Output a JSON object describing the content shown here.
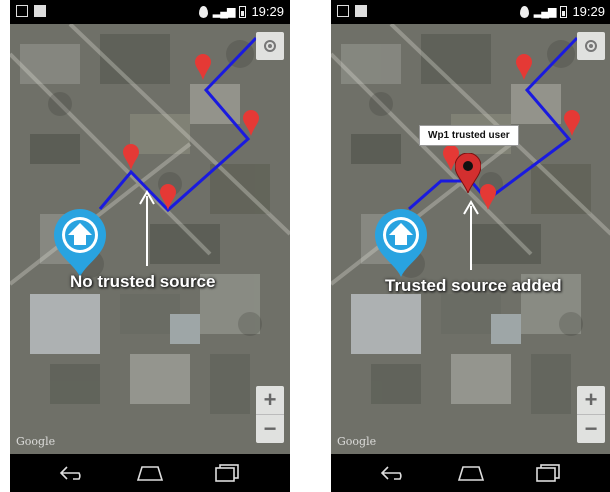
{
  "status_bar": {
    "time": "19:29"
  },
  "map": {
    "attribution": "Google",
    "zoom_in_label": "+",
    "zoom_out_label": "−"
  },
  "left_panel": {
    "annotation": "No trusted source"
  },
  "right_panel": {
    "annotation": "Trusted source added",
    "tooltip": "Wp1 trusted user"
  },
  "colors": {
    "route": "#1a1adf",
    "marker": "#e53935",
    "trusted_marker": "#d32f2f",
    "home_marker": "#29a3e0"
  },
  "icons": {
    "locate": "my-location-icon",
    "back": "back-icon",
    "home": "home-icon",
    "recents": "recents-icon",
    "marker": "map-marker-icon",
    "home_marker": "home-marker-icon"
  }
}
